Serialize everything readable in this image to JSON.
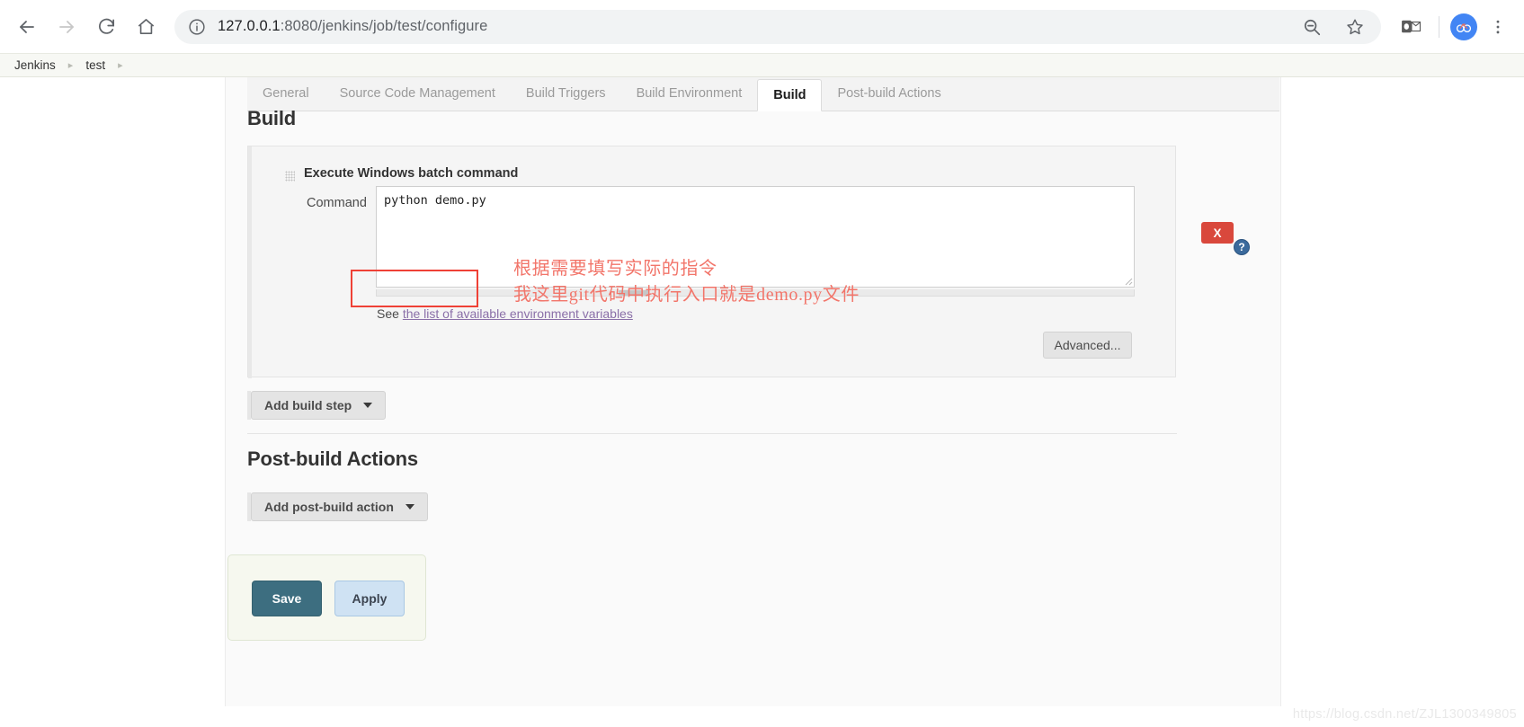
{
  "browser": {
    "url_host": "127.0.0.1",
    "url_rest": ":8080/jenkins/job/test/configure",
    "back_icon": "back-arrow-icon",
    "forward_icon": "forward-arrow-icon",
    "reload_icon": "reload-icon",
    "home_icon": "home-icon",
    "info_icon": "site-info-icon",
    "zoom_out_icon": "zoom-out-icon",
    "bookmark_icon": "star-icon",
    "extension_icon": "outlook-extension-icon",
    "profile_icon": "profile-avatar-icon",
    "menu_icon": "three-dot-menu-icon"
  },
  "breadcrumb": {
    "items": [
      "Jenkins",
      "test"
    ],
    "separator": "▸"
  },
  "tabs": [
    {
      "label": "General",
      "active": false
    },
    {
      "label": "Source Code Management",
      "active": false
    },
    {
      "label": "Build Triggers",
      "active": false
    },
    {
      "label": "Build Environment",
      "active": false
    },
    {
      "label": "Build",
      "active": true
    },
    {
      "label": "Post-build Actions",
      "active": false
    }
  ],
  "build_section": {
    "title": "Build",
    "step": {
      "name": "Execute Windows batch command",
      "command_label": "Command",
      "command_value": "python demo.py",
      "see_prefix": "See ",
      "see_link": "the list of available environment variables",
      "advanced_label": "Advanced...",
      "close_label": "X",
      "help_label": "?"
    },
    "add_build_step_label": "Add build step"
  },
  "postbuild_section": {
    "title": "Post-build Actions",
    "add_postbuild_label": "Add post-build action"
  },
  "form_actions": {
    "save_label": "Save",
    "apply_label": "Apply"
  },
  "annotations": {
    "line1": "根据需要填写实际的指令",
    "line2": "我这里git代码中执行入口就是demo.py文件",
    "box_color": "#ef4136",
    "text_color": "#f2756a"
  },
  "watermark": "https://blog.csdn.net/ZJL1300349805",
  "colors": {
    "save_button": "#3d6e80",
    "apply_button": "#cfe2f3",
    "close_button": "#d9483c",
    "link": "#8a6fa8"
  }
}
